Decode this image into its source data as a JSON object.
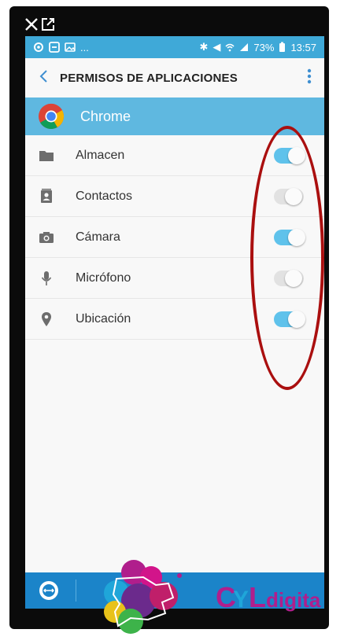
{
  "status_bar": {
    "battery": "73%",
    "time": "13:57"
  },
  "app_bar": {
    "title": "PERMISOS DE APLICACIONES"
  },
  "app": {
    "name": "Chrome"
  },
  "permissions": [
    {
      "label": "Almacen",
      "icon": "folder-icon",
      "enabled": true
    },
    {
      "label": "Contactos",
      "icon": "contacts-icon",
      "enabled": false
    },
    {
      "label": "Cámara",
      "icon": "camera-icon",
      "enabled": true
    },
    {
      "label": "Micrófono",
      "icon": "microphone-icon",
      "enabled": false
    },
    {
      "label": "Ubicación",
      "icon": "location-icon",
      "enabled": true
    }
  ],
  "watermark": {
    "text": "digita"
  },
  "colors": {
    "status_bar": "#3fa9d8",
    "header": "#5fb8e0",
    "toggle_on": "#5fc2eb",
    "nav_bar": "#1b84c9",
    "annotation": "#aa0f0f"
  }
}
